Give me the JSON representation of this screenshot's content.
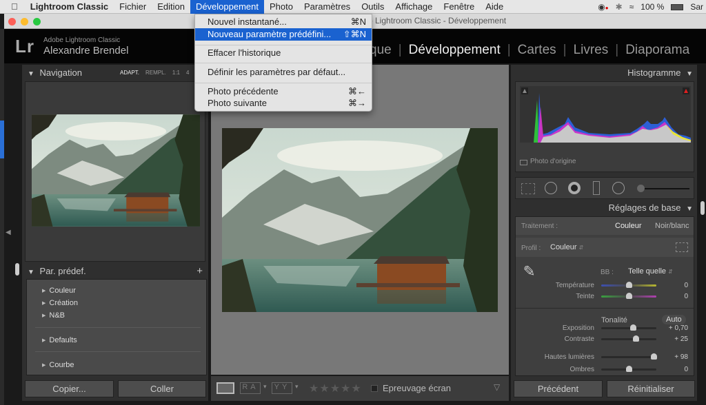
{
  "menubar": {
    "apple_icon": "apple-icon",
    "items": [
      "Lightroom Classic",
      "Fichier",
      "Edition",
      "Développement",
      "Photo",
      "Paramètres",
      "Outils",
      "Affichage",
      "Fenêtre",
      "Aide"
    ],
    "active": "Développement",
    "status": {
      "battery": "100 %",
      "user": "Sar"
    }
  },
  "window": {
    "title": "p Lightroom Classic - Développement"
  },
  "lr_header": {
    "logo": "Lr",
    "product": "Adobe Lightroom Classic",
    "user": "Alexandre Brendel",
    "modules": [
      "que",
      "Développement",
      "Cartes",
      "Livres",
      "Diaporama"
    ],
    "active_module": "Développement",
    "separator": "|"
  },
  "dropdown": {
    "items": [
      {
        "label": "Nouvel instantané...",
        "shortcut": "⌘N"
      },
      {
        "label": "Nouveau paramètre prédéfini...",
        "shortcut": "⇧⌘N",
        "highlighted": true
      },
      {
        "label": "Effacer l'historique",
        "shortcut": ""
      },
      {
        "label": "Définir les paramètres par défaut...",
        "shortcut": ""
      },
      {
        "label": "Photo précédente",
        "shortcut": "⌘←"
      },
      {
        "label": "Photo suivante",
        "shortcut": "⌘→"
      }
    ]
  },
  "left_panel": {
    "navigation": {
      "title": "Navigation",
      "zoom_options": [
        "ADAPT.",
        "REMPL.",
        "1:1",
        "4"
      ]
    },
    "presets": {
      "title": "Par. prédef.",
      "add": "+",
      "items": [
        "Couleur",
        "Création",
        "N&B",
        "Defaults",
        "Courbe"
      ]
    },
    "buttons": {
      "copy": "Copier...",
      "paste": "Coller"
    }
  },
  "toolbar": {
    "rating_stars": "★★★★★",
    "rating": 0,
    "soft_proof": "Epreuvage écran",
    "soft_proof_checked": false,
    "ra": "RA",
    "yy": "YY"
  },
  "right_panel": {
    "histogram": {
      "title": "Histogramme",
      "original_photo": "Photo d'origine"
    },
    "basic": {
      "title": "Réglages de base",
      "treatment_label": "Traitement :",
      "treatment_color": "Couleur",
      "treatment_bw": "Noir/blanc",
      "profile_label": "Profil :",
      "profile_value": "Couleur",
      "wb_label": "BB :",
      "wb_value": "Telle quelle",
      "tone_label": "Tonalité",
      "auto": "Auto",
      "sliders": [
        {
          "label": "Température",
          "value": "0",
          "position": 0.5
        },
        {
          "label": "Teinte",
          "value": "0",
          "position": 0.5
        },
        {
          "label": "Exposition",
          "value": "+ 0,70",
          "position": 0.57
        },
        {
          "label": "Contraste",
          "value": "+ 25",
          "position": 0.62
        },
        {
          "label": "Hautes lumières",
          "value": "+ 98",
          "position": 0.95
        },
        {
          "label": "Ombres",
          "value": "0",
          "position": 0.5
        }
      ]
    },
    "buttons": {
      "previous": "Précédent",
      "reset": "Réinitialiser"
    }
  },
  "colors": {
    "menu_highlight": "#1a62d0",
    "panel": "#3a3a3a",
    "canvas": "#777777"
  }
}
